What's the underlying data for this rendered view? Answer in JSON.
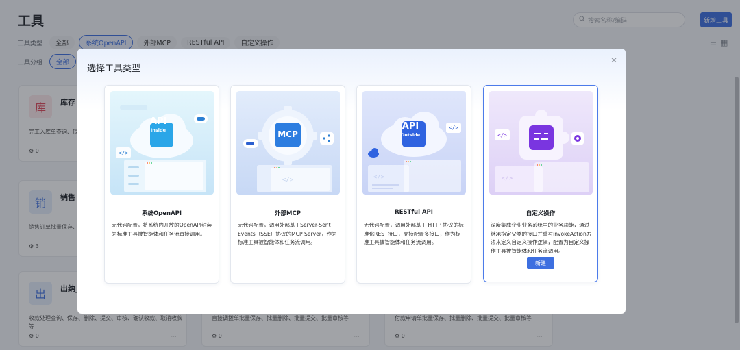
{
  "page": {
    "title": "工具",
    "search_placeholder": "搜索名称/编码",
    "new_tool_label": "新增工具",
    "view_list_icon": "list-icon",
    "view_grid_icon": "grid-icon"
  },
  "filters": {
    "type_label": "工具类型",
    "type_chips": [
      "全部",
      "系统OpenAPI",
      "外部MCP",
      "RESTful API",
      "自定义操作"
    ],
    "type_active": "系统OpenAPI",
    "group_label": "工具分组",
    "group_chips": [
      "全部"
    ]
  },
  "tool_cards": [
    {
      "avatar": "库",
      "name": "库存",
      "desc": "完工入库单查询、提",
      "count": "0",
      "color": "#fde8ea",
      "fg": "#e0495a"
    },
    {
      "avatar": "销",
      "name": "销售",
      "desc": "销售订单批量保存、",
      "count": "3",
      "color": "#e5eefc",
      "fg": "#3d6fe0"
    },
    {
      "avatar": "出",
      "name": "出纳_",
      "desc": "收款处理查询、保存、删除、提交、审核、确认收款、取消收款等",
      "count": "0",
      "color": "#e5eefc",
      "fg": "#3d6fe0"
    },
    {
      "avatar": "",
      "name": "",
      "desc": "直接调拨单批量保存、批量删除、批量提交、批量审核等",
      "count": "0"
    },
    {
      "avatar": "",
      "name": "",
      "desc": "付款申请单批量保存、批量删除、批量提交、批量审核等",
      "count": "0"
    }
  ],
  "modal": {
    "title": "选择工具类型",
    "close_icon": "close-icon",
    "cards": [
      {
        "name": "系统OpenAPI",
        "badge": "API",
        "badge_sub": "Inside",
        "desc": "无代码配置，将系统内开放的OpenAPI封装为标准工具被智能体和任务流直接调用。"
      },
      {
        "name": "外部MCP",
        "badge": "MCP",
        "badge_sub": "",
        "desc": "无代码配置，调用外部基于Server-Sent Events（SSE）协议的MCP Server，作为标准工具被智能体和任务流调用。"
      },
      {
        "name": "RESTful API",
        "badge": "API",
        "badge_sub": "Outside",
        "desc": "无代码配置，调用外部基于 HTTP 协议的标准化REST接口，支持配置多接口，作为标准工具被智能体和任务流调用。"
      },
      {
        "name": "自定义操作",
        "badge": "",
        "badge_sub": "",
        "desc": "深度集成企业业务系统中的业务功能，通过继承指定父类的接口并重写invokeAction方法来定义自定义操作逻辑，配置为自定义操作工具被智能体和任务流调用。",
        "button": "新建"
      }
    ]
  },
  "colors": {
    "accent": "#3d6fe0",
    "selected_border": "#4c7bea"
  }
}
